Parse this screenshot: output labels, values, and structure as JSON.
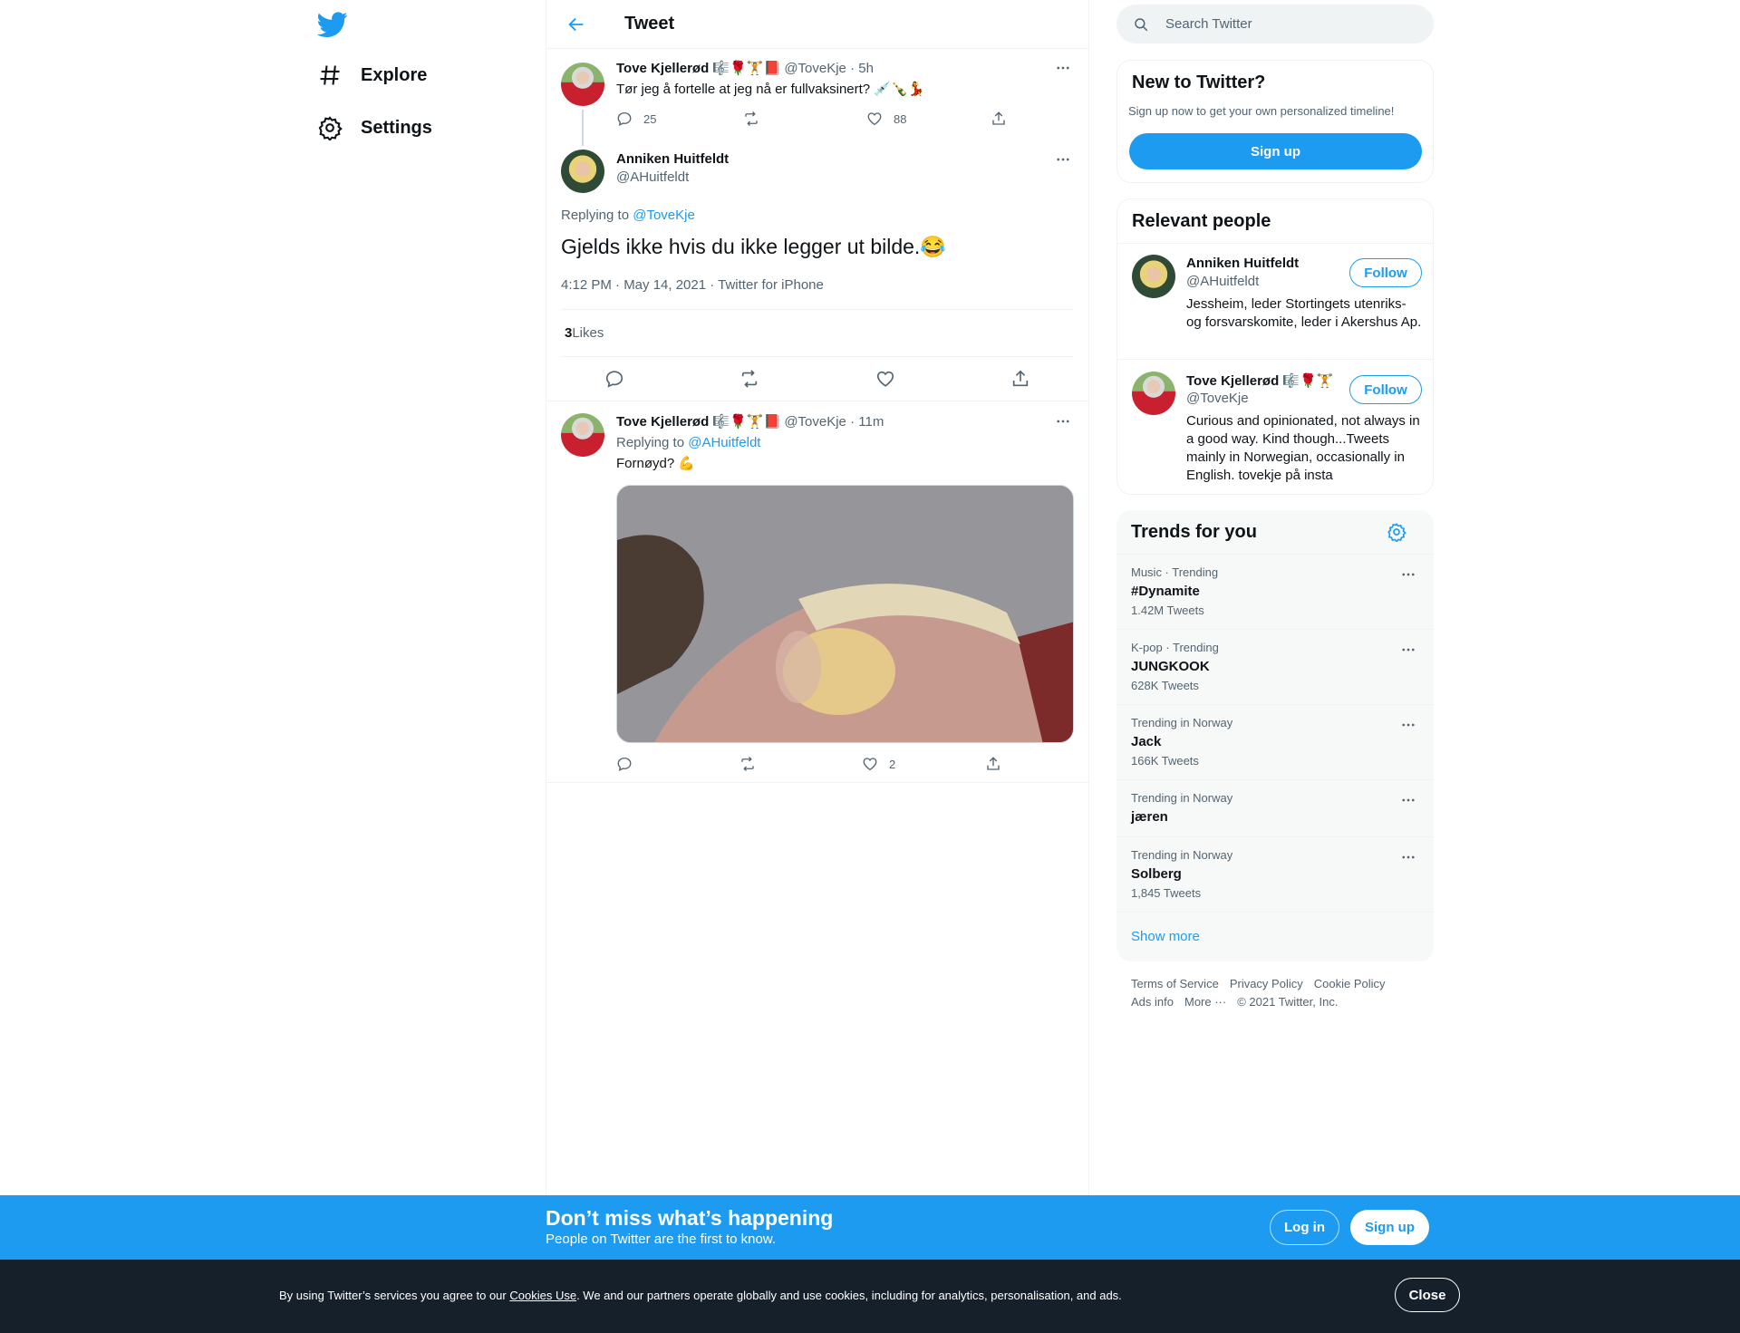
{
  "colors": {
    "accent": "#1d9bf0",
    "text": "#0f1419",
    "muted": "#536471",
    "border": "#eff3f4",
    "cookie_bg": "#15202b"
  },
  "nav": {
    "logo": "twitter-bird-icon",
    "explore": "Explore",
    "settings": "Settings"
  },
  "header": {
    "title": "Tweet"
  },
  "tweet1": {
    "name": "Tove Kjellerød",
    "emojis": "🎼🌹🏋📕",
    "handle": "@ToveKje",
    "sep": " · ",
    "time": "5h",
    "text": "Tør jeg å fortelle at jeg nå er fullvaksinert? 💉🍾💃",
    "replies": "25",
    "likes": "88"
  },
  "main_tweet": {
    "name": "Anniken Huitfeldt",
    "handle": "@AHuitfeldt",
    "replying_prefix": "Replying to ",
    "replying_to": "@ToveKje",
    "text": "Gjelds ikke hvis du ikke legger ut bilde.😂",
    "meta": "4:12 PM · May 14, 2021 · Twitter for iPhone",
    "likes_count": "3",
    "likes_label": " Likes"
  },
  "tweet3": {
    "name": "Tove Kjellerød",
    "emojis": "🎼🌹🏋📕",
    "handle": "@ToveKje",
    "sep": " · ",
    "time": "11m",
    "replying_prefix": "Replying to ",
    "replying_to": "@AHuitfeldt",
    "text": "Fornøyd? 💪",
    "likes": "2"
  },
  "search": {
    "placeholder": "Search Twitter"
  },
  "new_to_twitter": {
    "title": "New to Twitter?",
    "subtitle": "Sign up now to get your own personalized timeline!",
    "button": "Sign up"
  },
  "relevant": {
    "title": "Relevant people",
    "people": [
      {
        "name": "Anniken Huitfeldt",
        "emojis": "",
        "handle": "@AHuitfeldt",
        "bio": "Jessheim, leder Stortingets utenriks- og forsvarskomite, leder i Akershus Ap.",
        "button": "Follow"
      },
      {
        "name": "Tove Kjellerød",
        "emojis": "🎼🌹🏋",
        "handle": "@ToveKje",
        "bio": "Curious and opinionated, not always in a good way. Kind though...Tweets mainly in Norwegian, occasionally in English. tovekje på insta",
        "button": "Follow"
      }
    ]
  },
  "trends": {
    "title": "Trends for you",
    "items": [
      {
        "context": "Music · Trending",
        "name": "#Dynamite",
        "count": "1.42M Tweets"
      },
      {
        "context": "K-pop · Trending",
        "name": "JUNGKOOK",
        "count": "628K Tweets"
      },
      {
        "context": "Trending in Norway",
        "name": "Jack",
        "count": "166K Tweets"
      },
      {
        "context": "Trending in Norway",
        "name": "jæren",
        "count": ""
      },
      {
        "context": "Trending in Norway",
        "name": "Solberg",
        "count": "1,845 Tweets"
      }
    ],
    "show_more": "Show more"
  },
  "footer": {
    "terms": "Terms of Service",
    "privacy": "Privacy Policy",
    "cookie": "Cookie Policy",
    "ads": "Ads info",
    "more": "More ···",
    "copyright": "© 2021 Twitter, Inc."
  },
  "banner": {
    "title": "Don’t miss what’s happening",
    "subtitle": "People on Twitter are the first to know.",
    "login": "Log in",
    "signup": "Sign up"
  },
  "cookie": {
    "prefix": "By using Twitter’s services you agree to our ",
    "link": "Cookies Use",
    "suffix": ". We and our partners operate globally and use cookies, including for analytics, personalisation, and ads.",
    "close": "Close"
  }
}
